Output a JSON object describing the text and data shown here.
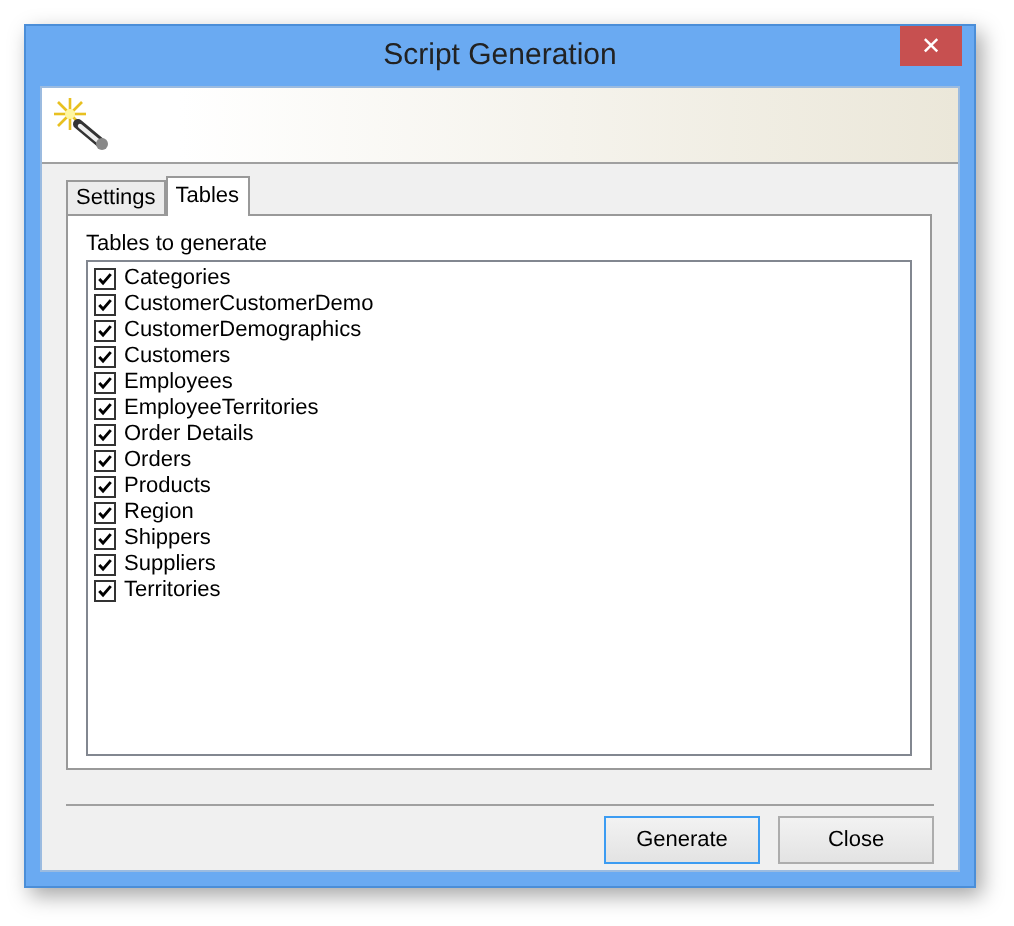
{
  "window": {
    "title": "Script Generation",
    "close": "✕"
  },
  "tabs": [
    {
      "label": "Settings",
      "selected": false
    },
    {
      "label": "Tables",
      "selected": true
    }
  ],
  "tables_label": "Tables to generate",
  "tables": [
    {
      "name": "Categories",
      "checked": true
    },
    {
      "name": "CustomerCustomerDemo",
      "checked": true
    },
    {
      "name": "CustomerDemographics",
      "checked": true
    },
    {
      "name": "Customers",
      "checked": true
    },
    {
      "name": "Employees",
      "checked": true
    },
    {
      "name": "EmployeeTerritories",
      "checked": true
    },
    {
      "name": "Order Details",
      "checked": true
    },
    {
      "name": "Orders",
      "checked": true
    },
    {
      "name": "Products",
      "checked": true
    },
    {
      "name": "Region",
      "checked": true
    },
    {
      "name": "Shippers",
      "checked": true
    },
    {
      "name": "Suppliers",
      "checked": true
    },
    {
      "name": "Territories",
      "checked": true
    }
  ],
  "buttons": [
    {
      "label": "Generate",
      "default": true
    },
    {
      "label": "Close",
      "default": false
    }
  ]
}
